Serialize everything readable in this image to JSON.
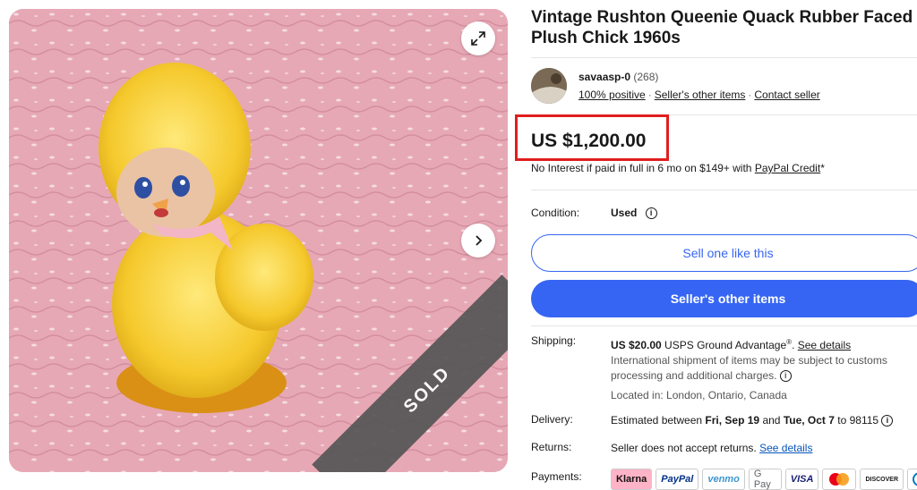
{
  "title": "Vintage Rushton Queenie Quack Rubber Faced Plush Chick 1960s",
  "gallery": {
    "sold_label": "SOLD",
    "expand_icon": "expand-icon",
    "next_icon": "chevron-right-icon"
  },
  "seller": {
    "name": "savaasp-0",
    "count": "(268)",
    "positive": "100% positive",
    "other_items": "Seller's other items",
    "contact": "Contact seller"
  },
  "price": {
    "amount": "US $1,200.00",
    "credit_text": "No Interest if paid in full in 6 mo on $149+ with ",
    "credit_link": "PayPal Credit",
    "credit_suffix": "*"
  },
  "condition": {
    "label": "Condition:",
    "value": "Used"
  },
  "buttons": {
    "sell_one": "Sell one like this",
    "sellers_other": "Seller's other items"
  },
  "shipping": {
    "label": "Shipping:",
    "cost": "US $20.00",
    "service": " USPS Ground Advantage",
    "reg": "®",
    "details_link": "See details",
    "intl_note": "International shipment of items may be subject to customs processing and additional charges.",
    "location": "Located in: London, Ontario, Canada"
  },
  "delivery": {
    "label": "Delivery:",
    "prefix": "Estimated between ",
    "start": "Fri, Sep 19",
    "and": " and ",
    "end": "Tue, Oct 7",
    "suffix": " to 98115"
  },
  "returns": {
    "label": "Returns:",
    "text": "Seller does not accept returns. ",
    "link": "See details"
  },
  "payments": {
    "label": "Payments:",
    "methods": [
      "Klarna",
      "PayPal",
      "venmo",
      "G Pay",
      "VISA",
      "MC",
      "DISCOVER",
      "DC"
    ]
  },
  "colors": {
    "accent": "#3665f3",
    "highlight_box": "#e01e1e"
  }
}
